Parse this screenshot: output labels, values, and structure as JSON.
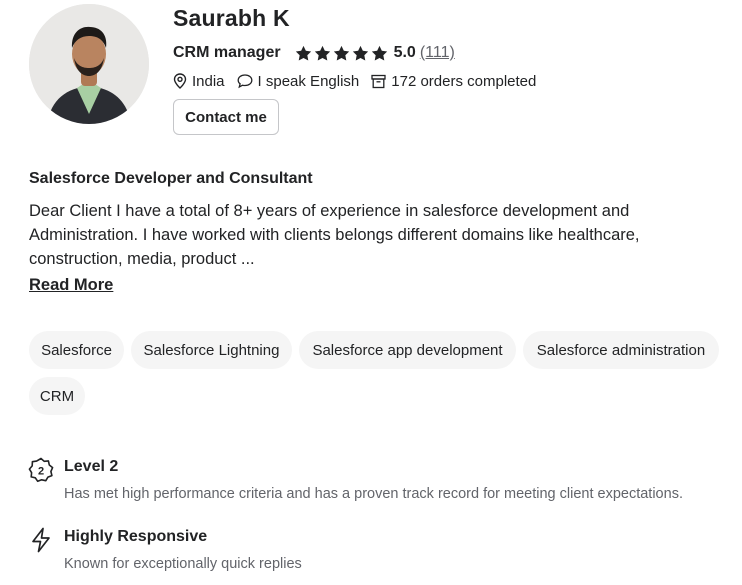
{
  "profile": {
    "name": "Saurabh K",
    "role": "CRM manager",
    "rating": "5.0",
    "reviews": "(111)",
    "country": "India",
    "language": "I speak English",
    "orders": "172 orders completed",
    "contact_label": "Contact me"
  },
  "about": {
    "headline": "Salesforce Developer and Consultant",
    "description": "Dear Client I have a total of 8+ years of experience in salesforce development and Administration. I have worked with clients belongs different domains like healthcare, construction, media, product ...",
    "read_more": "Read More"
  },
  "skills": [
    "Salesforce",
    "Salesforce Lightning",
    "Salesforce app development",
    "Salesforce administration",
    "CRM"
  ],
  "badges": [
    {
      "title": "Level 2",
      "icon_text": "2",
      "icon": "level-badge-icon",
      "description": "Has met high performance criteria and has a proven track record for meeting client expectations."
    },
    {
      "title": "Highly Responsive",
      "icon": "lightning-icon",
      "description": "Known for exceptionally quick replies"
    }
  ],
  "colors": {
    "text": "#222325",
    "muted": "#62646a",
    "chip_bg": "#f5f5f5",
    "star": "#222325"
  }
}
